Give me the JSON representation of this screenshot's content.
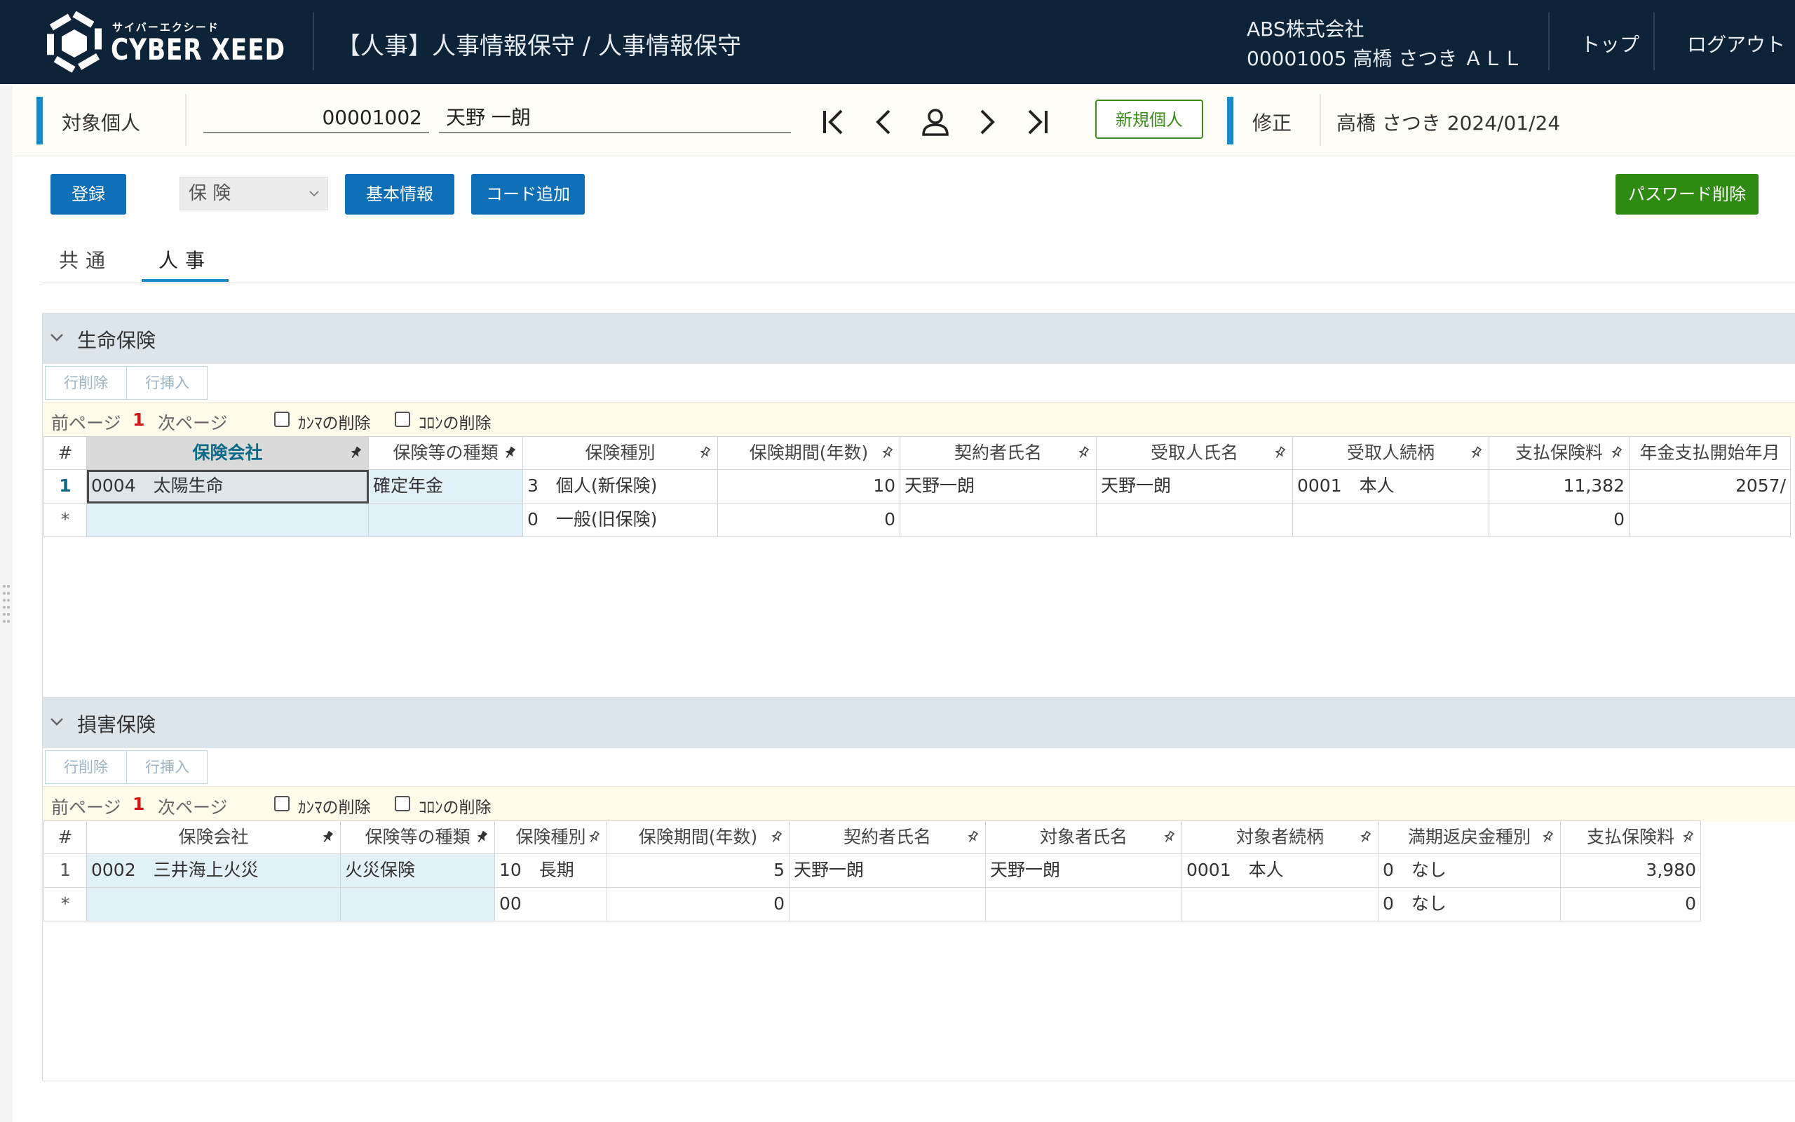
{
  "header": {
    "logo_kana": "サイバーエクシード",
    "logo_text": "CYBER XEED",
    "module_title": "【人事】人事情報保守 / 人事情報保守",
    "company": "ABS株式会社",
    "user": "00001005 高橋 さつき ＡＬＬ",
    "nav_top": "トップ",
    "nav_logout": "ログアウト"
  },
  "subject": {
    "label": "対象個人",
    "employee_code": "00001002",
    "employee_name": "天野 一朗",
    "new_person_label": "新規個人",
    "mode_label": "修正",
    "modified_info": "高橋 さつき 2024/01/24"
  },
  "toolbar": {
    "register_label": "登録",
    "category_select": "保 険",
    "basic_info_label": "基本情報",
    "add_code_label": "コード追加",
    "delete_password_label": "パスワード削除"
  },
  "tabs": [
    {
      "label": "共通",
      "active": false
    },
    {
      "label": "人事",
      "active": true
    }
  ],
  "life_insurance": {
    "title": "生命保険",
    "delete_row": "行削除",
    "insert_row": "行挿入",
    "prev_page": "前ページ",
    "page_no": "1",
    "next_page": "次ページ",
    "comma_delete": "ｶﾝﾏの削除",
    "colon_delete": "ｺﾛﾝの削除",
    "columns": [
      "#",
      "保険会社",
      "保険等の種類",
      "保険種別",
      "保険期間(年数)",
      "契約者氏名",
      "受取人氏名",
      "受取人続柄",
      "支払保険料",
      "年金支払開始年月"
    ],
    "rows": [
      [
        "1",
        "0004　太陽生命",
        "確定年金",
        "3　個人(新保険)",
        "10",
        "天野一朗",
        "天野一朗",
        "0001　本人",
        "11,382",
        "2057/"
      ],
      [
        "*",
        "",
        "",
        "0　一般(旧保険)",
        "0",
        "",
        "",
        "",
        "0",
        ""
      ]
    ]
  },
  "casualty_insurance": {
    "title": "損害保険",
    "delete_row": "行削除",
    "insert_row": "行挿入",
    "prev_page": "前ページ",
    "page_no": "1",
    "next_page": "次ページ",
    "comma_delete": "ｶﾝﾏの削除",
    "colon_delete": "ｺﾛﾝの削除",
    "columns": [
      "#",
      "保険会社",
      "保険等の種類",
      "保険種別",
      "保険期間(年数)",
      "契約者氏名",
      "対象者氏名",
      "対象者続柄",
      "満期返戻金種別",
      "支払保険料"
    ],
    "rows": [
      [
        "1",
        "0002　三井海上火災",
        "火災保険",
        "10　長期",
        "5",
        "天野一朗",
        "天野一朗",
        "0001　本人",
        "0　なし",
        "3,980"
      ],
      [
        "*",
        "",
        "",
        "00",
        "0",
        "",
        "",
        "",
        "0　なし",
        "0"
      ]
    ]
  },
  "colors": {
    "header_bg": "#0d2337",
    "accent_blue": "#1a88c9",
    "button_blue": "#0f6fb6",
    "button_green": "#2f8a12",
    "lookup_cell": "#e2f1f7",
    "panel_header": "#dde5ec"
  }
}
